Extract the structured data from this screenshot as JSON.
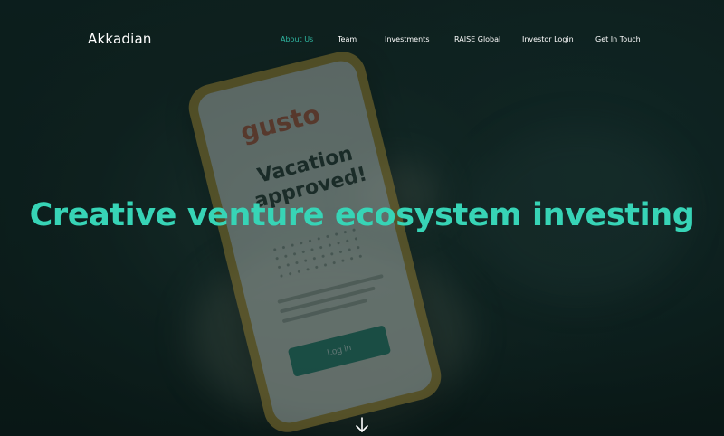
{
  "brand": {
    "name": "Akkadian"
  },
  "nav": {
    "items": [
      {
        "label": "About Us",
        "active": true
      },
      {
        "label": "Team",
        "active": false
      },
      {
        "label": "Investments",
        "active": false
      },
      {
        "label": "RAISE Global",
        "active": false
      },
      {
        "label": "Investor Login",
        "active": false
      },
      {
        "label": "Get In Touch",
        "active": false
      }
    ]
  },
  "hero": {
    "headline": "Creative venture ecosystem investing",
    "scroll_icon": "arrow-down-icon",
    "background_image": {
      "logo_text": "gusto",
      "title": "Vacation approved!",
      "button_label": "Log in"
    }
  },
  "colors": {
    "accent": "#37d4b6",
    "nav_active": "#2fb7a2",
    "background": "#0d1e1d",
    "text": "#ffffff"
  }
}
